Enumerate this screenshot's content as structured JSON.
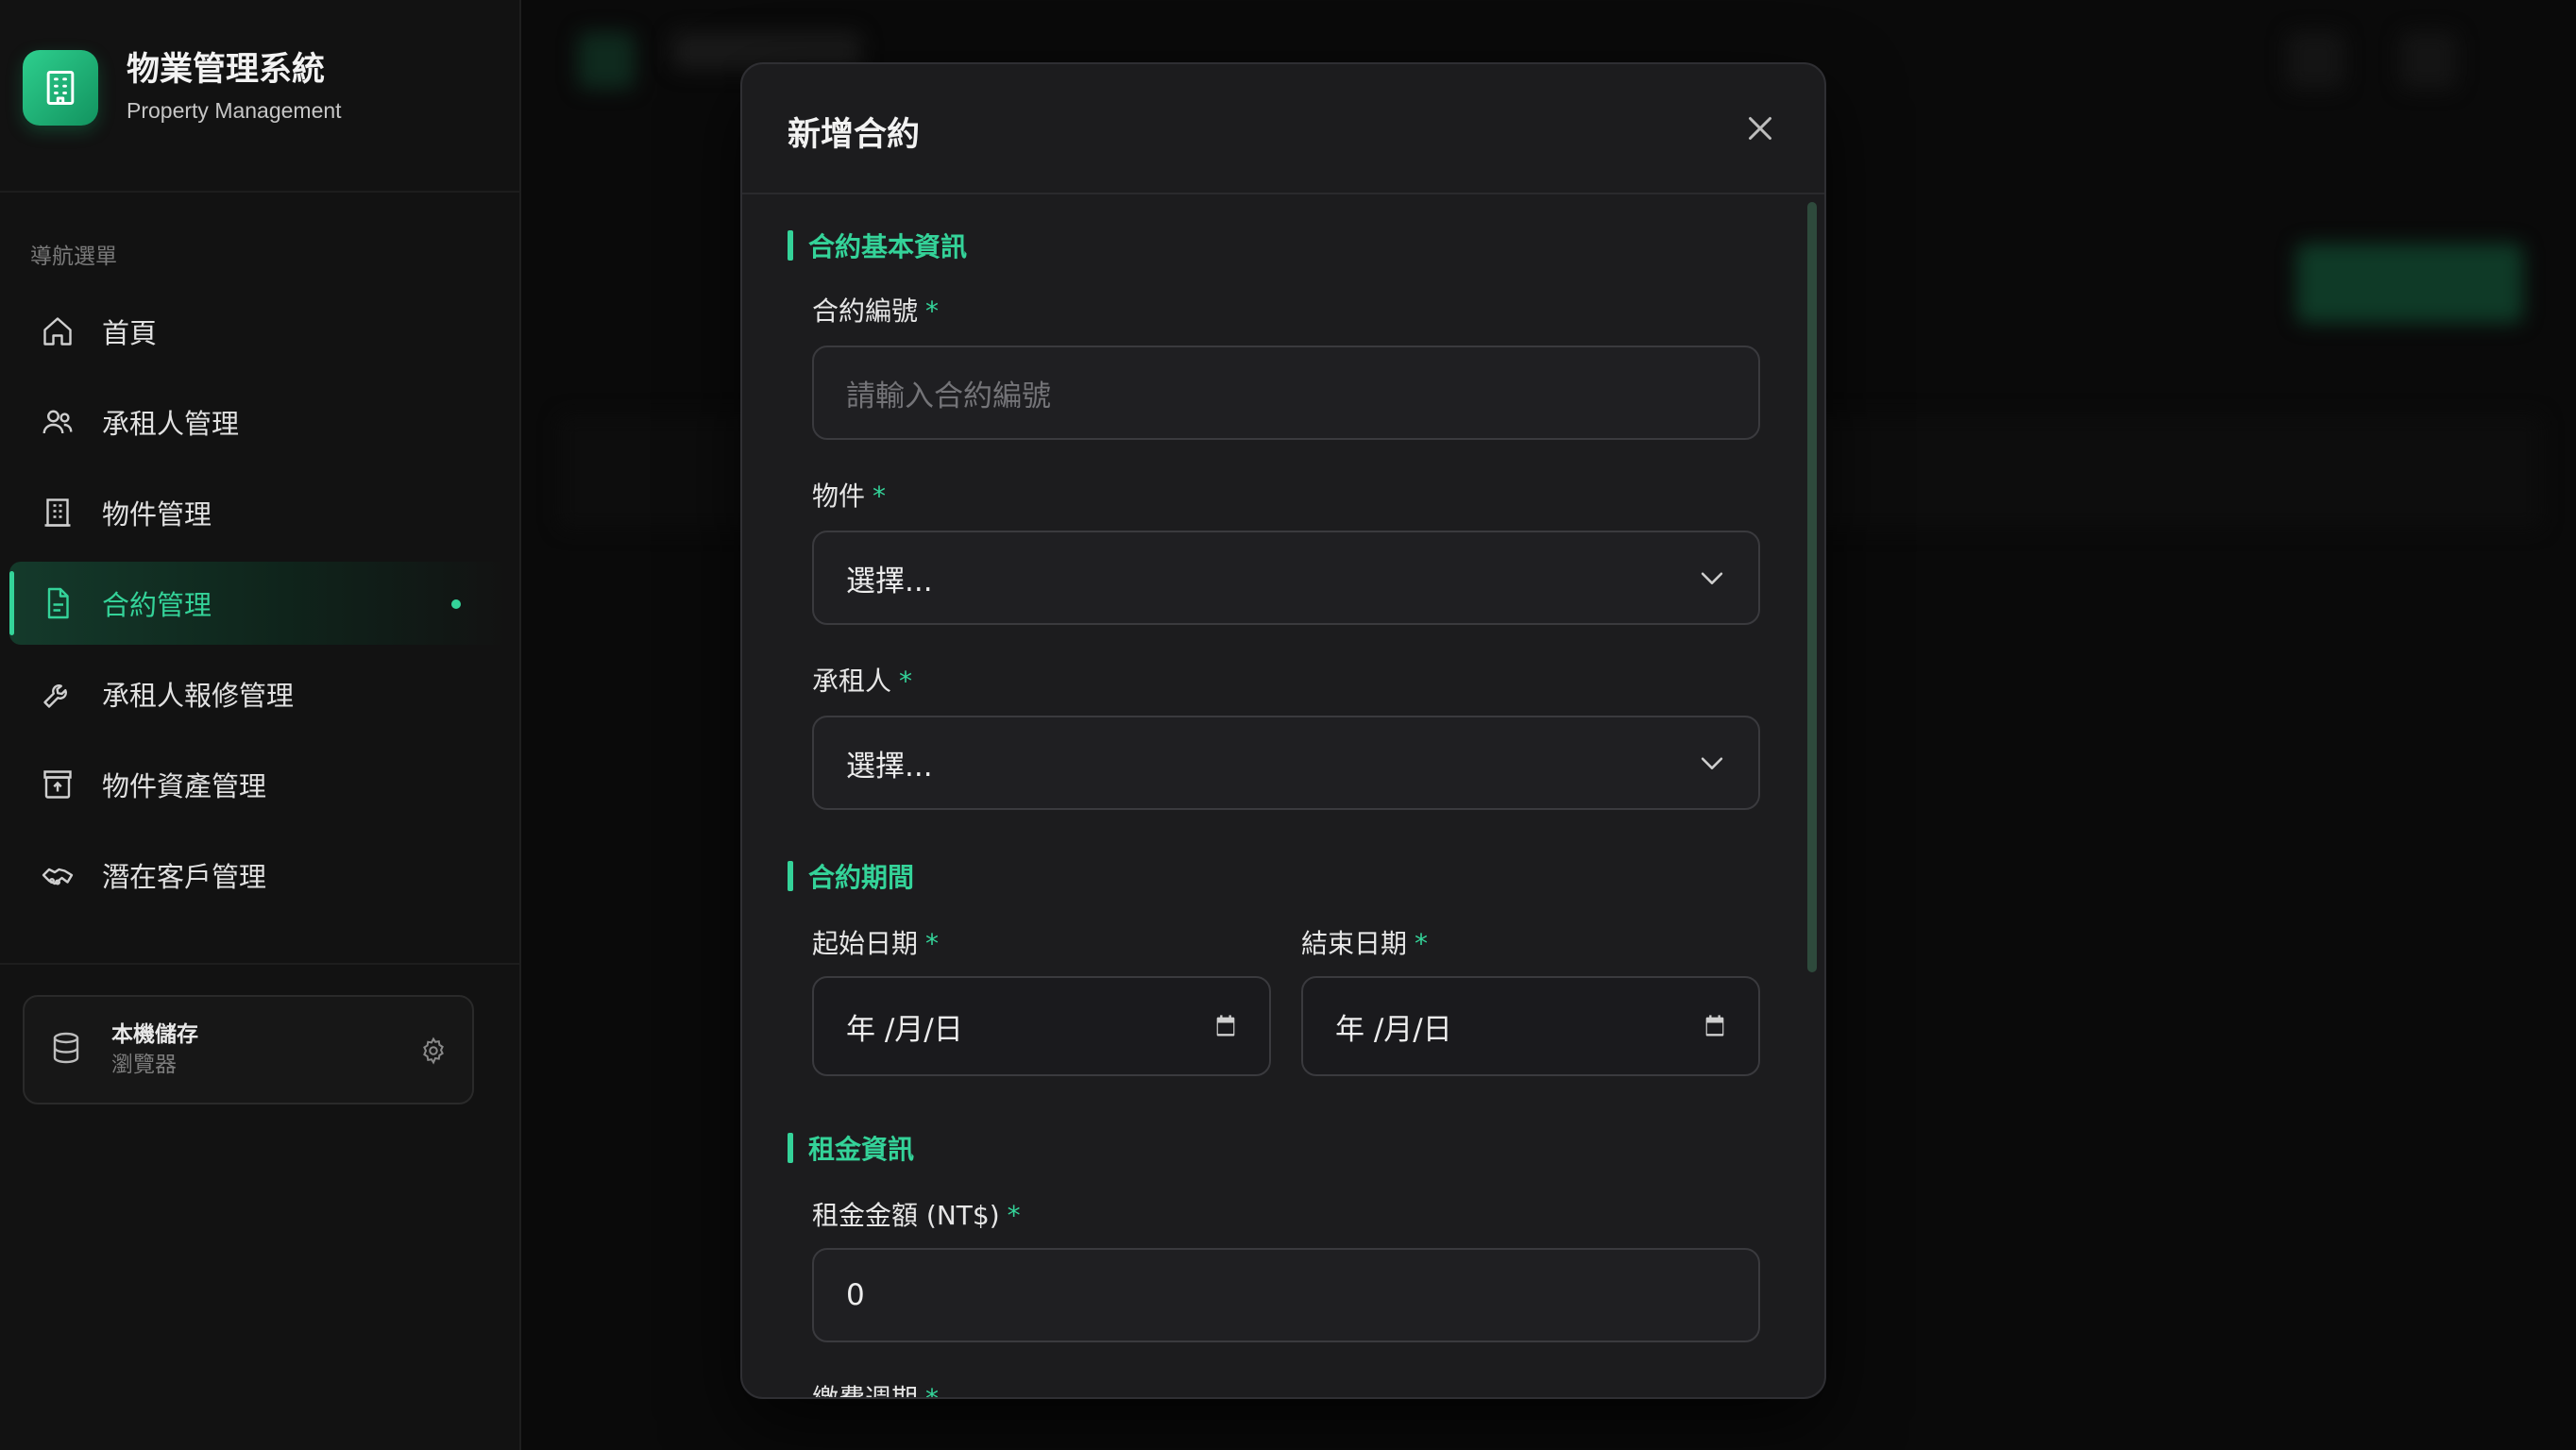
{
  "brand": {
    "title": "物業管理系統",
    "subtitle": "Property Management",
    "accent": "#34d399"
  },
  "sidebar": {
    "heading": "導航選單",
    "items": [
      {
        "label": "首頁",
        "icon": "home-icon",
        "active": false
      },
      {
        "label": "承租人管理",
        "icon": "users-icon",
        "active": false
      },
      {
        "label": "物件管理",
        "icon": "building-icon",
        "active": false
      },
      {
        "label": "合約管理",
        "icon": "document-icon",
        "active": true
      },
      {
        "label": "承租人報修管理",
        "icon": "wrench-icon",
        "active": false
      },
      {
        "label": "物件資產管理",
        "icon": "archive-icon",
        "active": false
      },
      {
        "label": "潛在客戶管理",
        "icon": "handshake-icon",
        "active": false
      }
    ],
    "storage": {
      "title": "本機儲存",
      "subtitle": "瀏覽器",
      "icon": "database-icon",
      "action_icon": "gear-icon"
    }
  },
  "modal": {
    "title": "新增合約",
    "close_icon": "close-icon",
    "sections": {
      "basic": {
        "title": "合約基本資訊",
        "contract_no": {
          "label": "合約編號",
          "required": "*",
          "placeholder": "請輸入合約編號"
        },
        "property": {
          "label": "物件",
          "required": "*",
          "value": "選擇..."
        },
        "tenant": {
          "label": "承租人",
          "required": "*",
          "value": "選擇..."
        }
      },
      "period": {
        "title": "合約期間",
        "start": {
          "label": "起始日期",
          "required": "*",
          "value": "年 /月/日"
        },
        "end": {
          "label": "結束日期",
          "required": "*",
          "value": "年 /月/日"
        }
      },
      "rent": {
        "title": "租金資訊",
        "amount": {
          "label": "租金金額 (NT$)",
          "required": "*",
          "value": "0"
        },
        "cycle": {
          "label": "繳費週期",
          "required": "*"
        }
      }
    }
  }
}
